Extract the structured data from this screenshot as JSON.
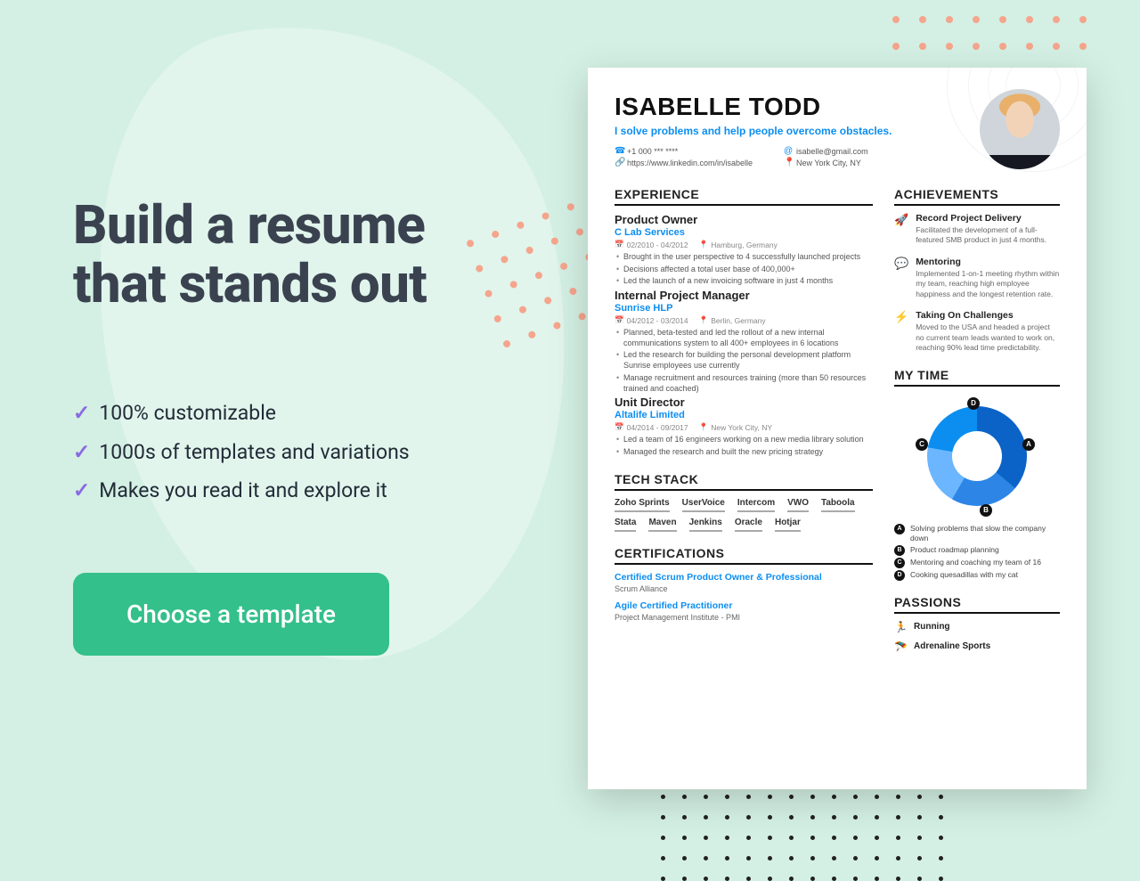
{
  "headline": "Build a resume that stands out",
  "features": [
    "100% customizable",
    "1000s of templates and variations",
    "Makes you read it and explore it"
  ],
  "cta": "Choose a template",
  "resume": {
    "name": "ISABELLE TODD",
    "tagline": "I solve problems and help people overcome obstacles.",
    "contact": {
      "phone": "+1 000 *** ****",
      "email": "isabelle@gmail.com",
      "linkedin": "https://www.linkedin.com/in/isabelle",
      "location": "New York City, NY"
    },
    "sections": {
      "experience": "EXPERIENCE",
      "tech_stack": "TECH STACK",
      "certifications": "CERTIFICATIONS",
      "achievements": "ACHIEVEMENTS",
      "my_time": "MY TIME",
      "passions": "PASSIONS"
    },
    "jobs": [
      {
        "title": "Product Owner",
        "company": "C Lab Services",
        "dates": "02/2010 - 04/2012",
        "location": "Hamburg, Germany",
        "bullets": [
          "Brought in the user perspective to 4 successfully launched projects",
          "Decisions affected a total user base of 400,000+",
          "Led the launch of a new invoicing software in just 4 months"
        ]
      },
      {
        "title": "Internal Project Manager",
        "company": "Sunrise HLP",
        "dates": "04/2012 - 03/2014",
        "location": "Berlin, Germany",
        "bullets": [
          "Planned, beta-tested and led the rollout of a new internal communications system to all 400+ employees in 6 locations",
          "Led the research for building the personal development platform Sunrise employees use currently",
          "Manage recruitment and resources training (more than 50 resources trained and coached)"
        ]
      },
      {
        "title": "Unit Director",
        "company": "Altalife Limited",
        "dates": "04/2014 - 09/2017",
        "location": "New York City, NY",
        "bullets": [
          "Led a team of 16 engineers working on a new media library solution",
          "Managed the research and built the new pricing strategy"
        ]
      }
    ],
    "tech_stack": [
      "Zoho Sprints",
      "UserVoice",
      "Intercom",
      "VWO",
      "Taboola",
      "Stata",
      "Maven",
      "Jenkins",
      "Oracle",
      "Hotjar"
    ],
    "certifications": [
      {
        "name": "Certified Scrum Product Owner & Professional",
        "org": "Scrum Alliance"
      },
      {
        "name": "Agile Certified Practitioner",
        "org": "Project Management Institute - PMI"
      }
    ],
    "achievements": [
      {
        "icon": "🚀",
        "title": "Record Project Delivery",
        "desc": "Facilitated the development of a full-featured SMB product in just 4 months."
      },
      {
        "icon": "💬",
        "title": "Mentoring",
        "desc": "Implemented 1-on-1 meeting rhythm within my team, reaching high employee happiness and the longest retention rate."
      },
      {
        "icon": "⚡",
        "title": "Taking On Challenges",
        "desc": "Moved to the USA and headed a project no current team leads wanted to work on, reaching 90% lead time predictability."
      }
    ],
    "my_time": [
      {
        "label": "A",
        "text": "Solving problems that slow the company down"
      },
      {
        "label": "B",
        "text": "Product roadmap planning"
      },
      {
        "label": "C",
        "text": "Mentoring and coaching my team of 16"
      },
      {
        "label": "D",
        "text": "Cooking quesadillas with my cat"
      }
    ],
    "passions": [
      {
        "icon": "🏃",
        "label": "Running"
      },
      {
        "icon": "🪂",
        "label": "Adrenaline Sports"
      }
    ]
  }
}
